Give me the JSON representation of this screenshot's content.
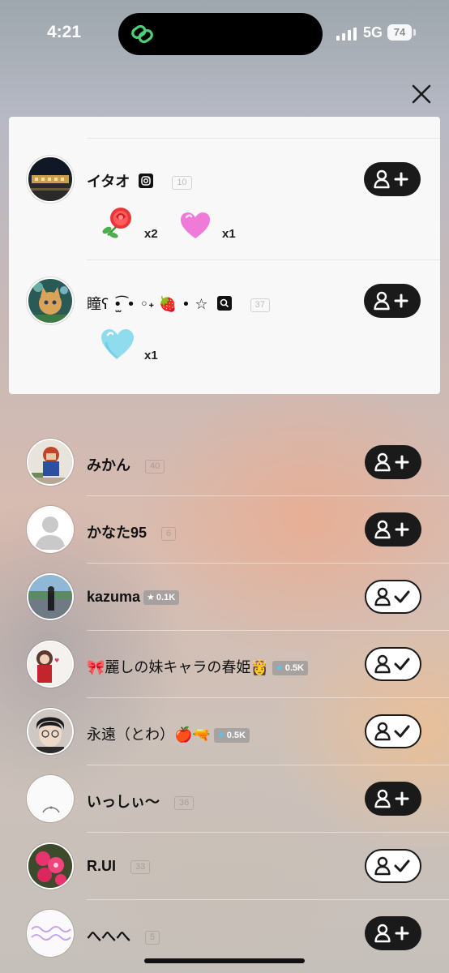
{
  "status_bar": {
    "time": "4:21",
    "network": "5G",
    "battery": "74"
  },
  "gifters": [
    {
      "name": "イタオ",
      "level": "10",
      "gifts": [
        {
          "icon": "rose-icon",
          "count": "x2"
        },
        {
          "icon": "pink-heart-icon",
          "count": "x1"
        }
      ]
    },
    {
      "name": "瞳ʕ •̫͡ • ◦˖ 🍓 • ☆",
      "level": "37",
      "gifts": [
        {
          "icon": "blue-heart-icon",
          "count": "x1"
        }
      ]
    }
  ],
  "viewers": [
    {
      "name": "みかん",
      "level": "40",
      "followed": false
    },
    {
      "name": "かなた95",
      "level": "6",
      "followed": false
    },
    {
      "name": "kazuma",
      "badge": "0.1K",
      "followed": true
    },
    {
      "name": "🎀麗しの妹キャラの春姫👸",
      "badge": "0.5K",
      "followed": true
    },
    {
      "name": "永遠（とわ）🍎🔫",
      "badge": "0.5K",
      "followed": true
    },
    {
      "name": "いっしぃ〜",
      "level": "36",
      "followed": false
    },
    {
      "name": "R.UI",
      "level": "33",
      "followed": true
    },
    {
      "name": "へへへ",
      "level": "5",
      "followed": false
    }
  ],
  "colors": {
    "button_dark": "#1a1a1a",
    "badge_blue": "#5bc4ea",
    "panel_bg": "#f8f8f8"
  }
}
